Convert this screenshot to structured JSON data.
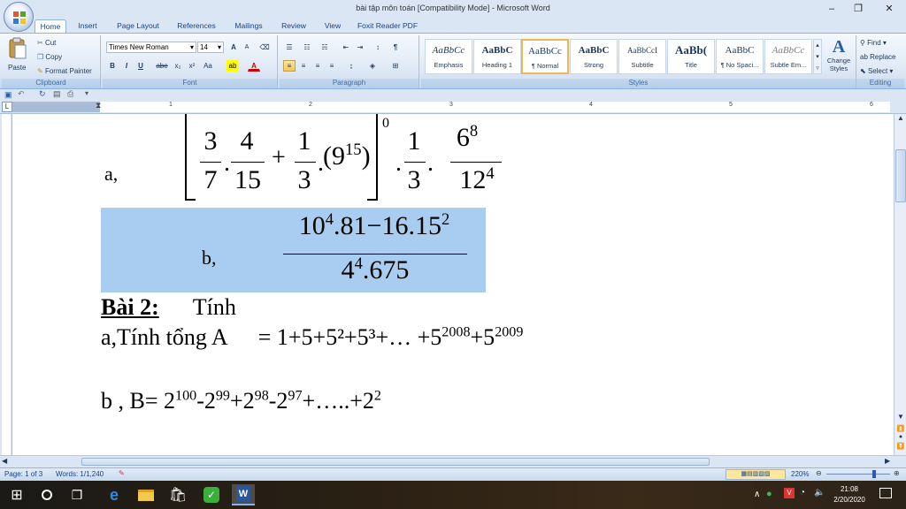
{
  "window": {
    "title": "bài tập môn toán [Compatibility Mode] - Microsoft Word",
    "minimize": "–",
    "maximize": "❐",
    "close": "✕"
  },
  "ribbon_tabs": [
    "Home",
    "Insert",
    "Page Layout",
    "References",
    "Mailings",
    "Review",
    "View",
    "Foxit Reader PDF"
  ],
  "clipboard": {
    "paste": "Paste",
    "cut": "Cut",
    "copy": "Copy",
    "format_painter": "Format Painter",
    "label": "Clipboard"
  },
  "font": {
    "name": "Times New Roman",
    "size": "14",
    "label": "Font",
    "bold": "B",
    "italic": "I",
    "underline": "U",
    "strike": "abe",
    "subscript": "x₂",
    "superscript": "x²",
    "change_case": "Aa",
    "grow": "A",
    "shrink": "A"
  },
  "paragraph": {
    "label": "Paragraph"
  },
  "styles": {
    "label": "Styles",
    "change_styles": "Change Styles",
    "items": [
      {
        "preview": "AaBbCc",
        "name": "Emphasis"
      },
      {
        "preview": "AaBbC",
        "name": "Heading 1"
      },
      {
        "preview": "AaBbCc",
        "name": "¶ Normal"
      },
      {
        "preview": "AaBbC",
        "name": "Strong"
      },
      {
        "preview": "AaBbCcI",
        "name": "Subtitle"
      },
      {
        "preview": "AaBb(",
        "name": "Title"
      },
      {
        "preview": "AaBbC",
        "name": "¶ No Spaci..."
      },
      {
        "preview": "AaBbCc",
        "name": "Subtle Em..."
      }
    ]
  },
  "editing": {
    "find": "Find",
    "replace": "Replace",
    "select": "Select",
    "label": "Editing"
  },
  "ruler": {
    "numbers": [
      "1",
      "2",
      "3",
      "4",
      "5",
      "6"
    ]
  },
  "document": {
    "line_a_label": "a,",
    "a_f1_num": "3",
    "a_f1_den": "7",
    "a_f2_num": "4",
    "a_f2_den": "15",
    "a_plus": "+",
    "a_f3_num": "1",
    "a_f3_den": "3",
    "a_base": "9",
    "a_exp": "15",
    "a_outer_exp": "0",
    "a_f4_num": "1",
    "a_f4_den": "3",
    "a_f5_num_base": "6",
    "a_f5_num_exp": "8",
    "a_f5_den_base": "12",
    "a_f5_den_exp": "4",
    "line_b_label": "b,",
    "b_num": {
      "p1": "10",
      "e1": "4",
      "p2": ".81−16.15",
      "e2": "2"
    },
    "b_den": {
      "p1": "4",
      "e1": "4",
      "p2": ".675"
    },
    "bai2_label": "Bài 2:",
    "bai2_text": "Tính",
    "sum_a_prefix": "a,Tính tổng A",
    "sum_a_expr": "= 1+5+5²+5³+… +5",
    "sum_a_e1": "2008",
    "sum_a_mid": "+5",
    "sum_a_e2": "2009",
    "sum_b": "b , B= 2",
    "sum_b_e1": "100",
    "sum_b_t2": "-2",
    "sum_b_e2": "99",
    "sum_b_t3": "+2",
    "sum_b_e3": "98",
    "sum_b_t4": "-2",
    "sum_b_e4": "97",
    "sum_b_t5": "+…..+2",
    "sum_b_e5": "2"
  },
  "status": {
    "page": "Page: 1 of 3",
    "words": "Words: 1/1,240",
    "zoom": "220%"
  },
  "clock": {
    "time": "21:08",
    "date": "2/20/2020"
  },
  "colors": {
    "ribbon_bg": "#dbe6f4",
    "selection": "#a9cdf0",
    "accent": "#15428b"
  }
}
